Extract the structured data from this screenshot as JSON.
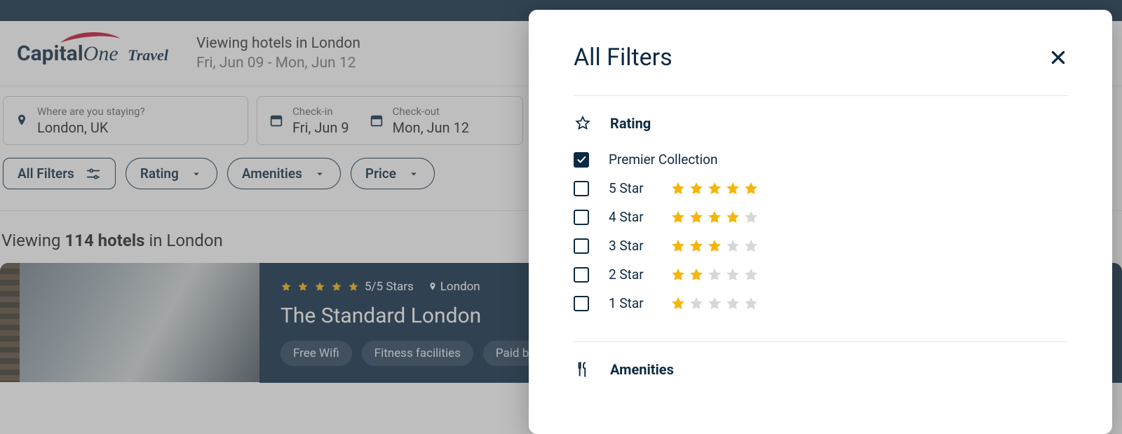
{
  "logo": {
    "brand_a": "Capital",
    "brand_b": "One",
    "sub": "Travel"
  },
  "header": {
    "title": "Viewing hotels in London",
    "dates": "Fri, Jun 09 - Mon, Jun 12"
  },
  "search": {
    "location_label": "Where are you staying?",
    "location_value": "London, UK",
    "checkin_label": "Check-in",
    "checkin_value": "Fri, Jun 9",
    "checkout_label": "Check-out",
    "checkout_value": "Mon, Jun 12"
  },
  "filter_buttons": {
    "all": "All Filters",
    "rating": "Rating",
    "amenities": "Amenities",
    "price": "Price"
  },
  "results": {
    "prefix": "Viewing ",
    "count": "114 hotels",
    "suffix": " in London"
  },
  "hotel": {
    "stars_text": "5/5 Stars",
    "city": "London",
    "name": "The Standard London",
    "tags": [
      "Free Wifi",
      "Fitness facilities",
      "Paid breakfa"
    ]
  },
  "panel": {
    "title": "All Filters",
    "rating_section": "Rating",
    "amenities_section": "Amenities",
    "options": [
      {
        "label": "Premier Collection",
        "checked": true,
        "stars": 0
      },
      {
        "label": "5 Star",
        "checked": false,
        "stars": 5
      },
      {
        "label": "4 Star",
        "checked": false,
        "stars": 4
      },
      {
        "label": "3 Star",
        "checked": false,
        "stars": 3
      },
      {
        "label": "2 Star",
        "checked": false,
        "stars": 2
      },
      {
        "label": "1 Star",
        "checked": false,
        "stars": 1
      }
    ]
  },
  "colors": {
    "brand": "#0d2a42",
    "accent_red": "#c41230",
    "star_gold": "#f5b50a"
  }
}
